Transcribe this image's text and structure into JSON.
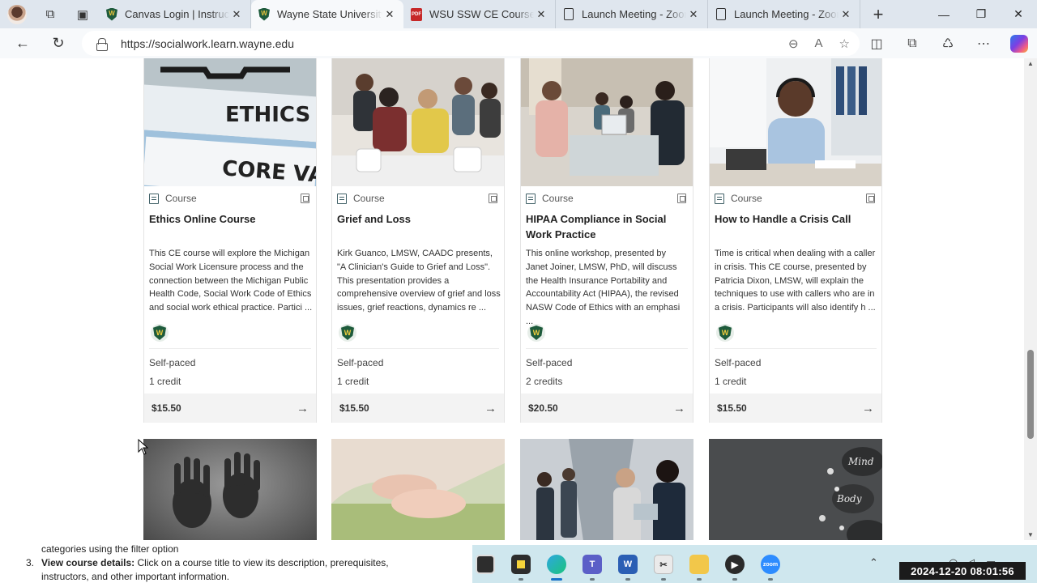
{
  "browser": {
    "tabs": [
      {
        "title": "Canvas Login | Instructu",
        "icon": "wsu-shield",
        "active": false
      },
      {
        "title": "Wayne State University",
        "icon": "wsu-shield",
        "active": true
      },
      {
        "title": "WSU SSW CE Course Vi",
        "icon": "pdf",
        "active": false
      },
      {
        "title": "Launch Meeting - Zoom",
        "icon": "document",
        "active": false
      },
      {
        "title": "Launch Meeting - Zoom",
        "icon": "document",
        "active": false
      }
    ],
    "new_tab": "+",
    "url": "https://socialwork.learn.wayne.edu"
  },
  "courses": [
    {
      "kind": "Course",
      "title": "Ethics Online Course",
      "description": "This CE course will explore the Michigan Social Work Licensure process and the connection between the Michigan Public Health Code, Social Work Code of Ethics and social work ethical practice. Partici ...",
      "pace": "Self-paced",
      "credits": "1 credit",
      "price": "$15.50",
      "image_text": [
        "ETHICS",
        "CORE VALUES"
      ]
    },
    {
      "kind": "Course",
      "title": "Grief and Loss",
      "description": "Kirk Guanco, LMSW, CAADC presents, \"A Clinician's Guide to Grief and Loss\". This presentation provides a comprehensive overview of grief and loss issues, grief reactions, dynamics re ...",
      "pace": "Self-paced",
      "credits": "1 credit",
      "price": "$15.50"
    },
    {
      "kind": "Course",
      "title": "HIPAA Compliance in Social Work Practice",
      "description": "This online workshop, presented by Janet Joiner, LMSW, PhD, will discuss the Health Insurance Portability and Accountability Act (HIPAA), the revised NASW Code of Ethics with an emphasi ...",
      "pace": "Self-paced",
      "credits": "2 credits",
      "price": "$20.50"
    },
    {
      "kind": "Course",
      "title": "How to Handle a Crisis Call",
      "description": "Time is critical when dealing with a caller in crisis. This CE course, presented by Patricia Dixon, LMSW, will explain the techniques to use with callers who are in a crisis. Participants will also identify h ...",
      "pace": "Self-paced",
      "credits": "1 credit",
      "price": "$15.50"
    }
  ],
  "second_row_image_text": [
    "Mind",
    "Body"
  ],
  "doc": {
    "line1": "categories using the filter option",
    "num": "3.",
    "bold": "View course details:",
    "line2": " Click on a course title to view its description, prerequisites,",
    "line3": "instructors, and other important information."
  },
  "taskbar": {
    "clock": "2024-12-20  08:01:56"
  },
  "colors": {
    "wsu_green": "#1e5b3c",
    "wsu_gold": "#f0cc3e",
    "taskbar_bg": "#cfe7ee"
  }
}
